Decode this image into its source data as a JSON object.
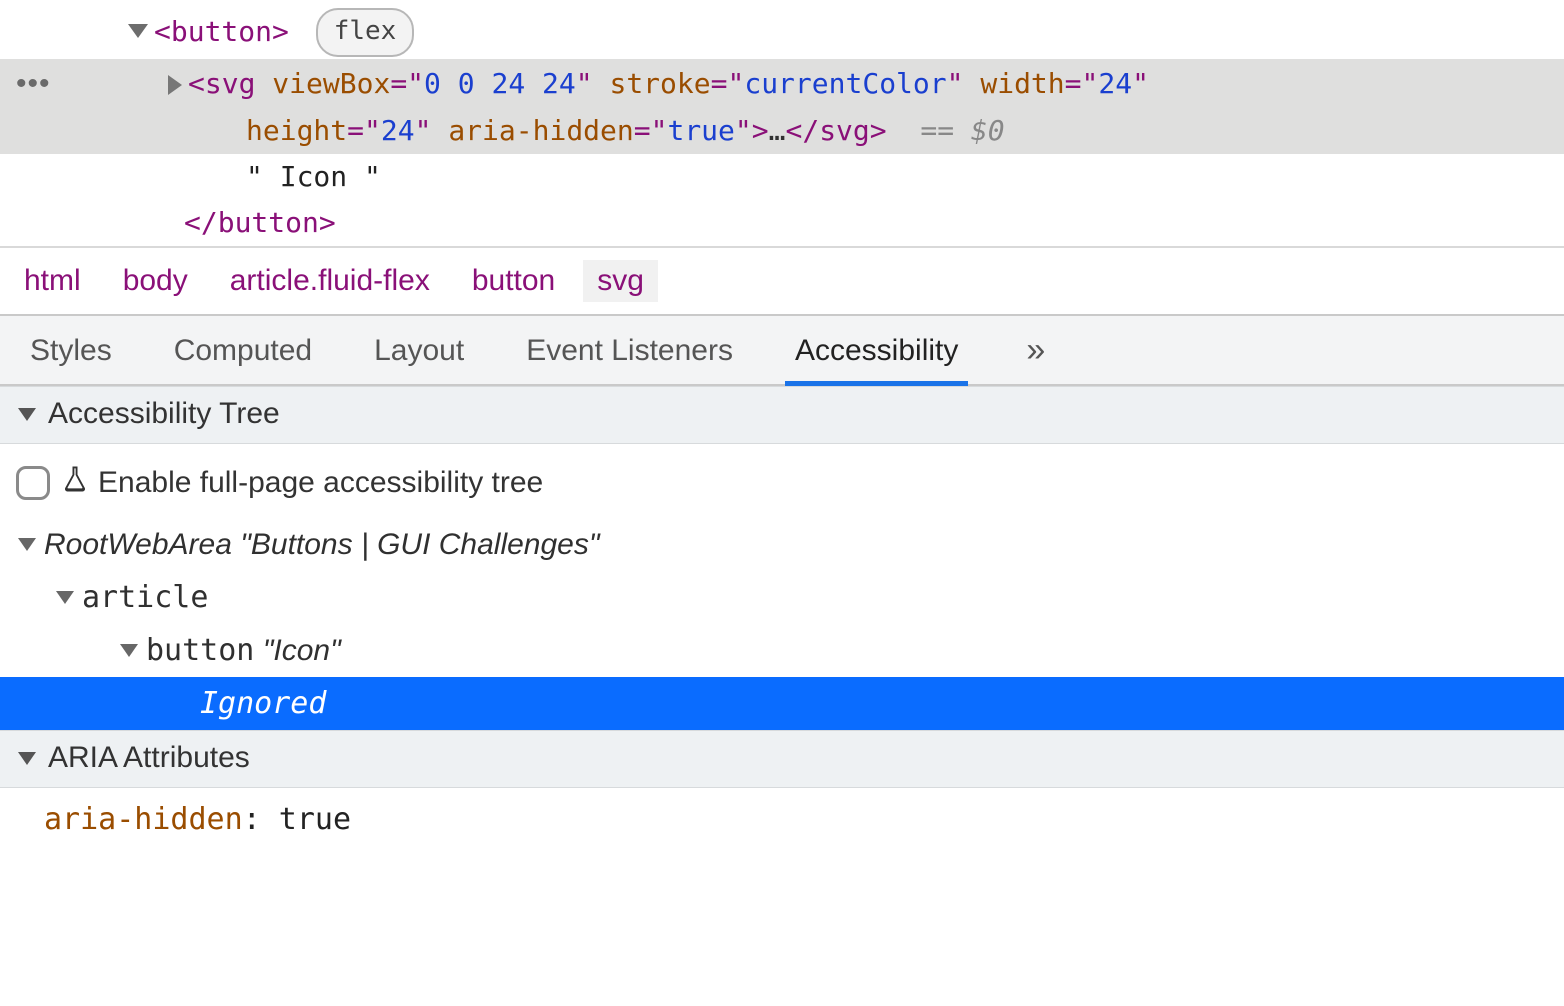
{
  "dom": {
    "button_open": "<button>",
    "button_close": "</button>",
    "flex_badge": "flex",
    "svg": {
      "prefix": "<svg",
      "attrs": [
        {
          "n": "viewBox",
          "v": "0 0 24 24"
        },
        {
          "n": "stroke",
          "v": "currentColor"
        },
        {
          "n": "width",
          "v": "24"
        },
        {
          "n": "height",
          "v": "24"
        },
        {
          "n": "aria-hidden",
          "v": "true"
        }
      ],
      "suffix_ellipsis": "…",
      "close": "</svg>",
      "eqvar": "== $0"
    },
    "text_node": "\" Icon \""
  },
  "breadcrumb": [
    "html",
    "body",
    "article.fluid-flex",
    "button",
    "svg"
  ],
  "tabs": {
    "items": [
      "Styles",
      "Computed",
      "Layout",
      "Event Listeners",
      "Accessibility"
    ],
    "active": "Accessibility",
    "more": "»"
  },
  "sections": {
    "tree_header": "Accessibility Tree",
    "aria_header": "ARIA Attributes"
  },
  "enable_label": "Enable full-page accessibility tree",
  "a11y_tree": {
    "root_role": "RootWebArea",
    "root_name": "\"Buttons | GUI Challenges\"",
    "article_role": "article",
    "button_role": "button",
    "button_name": "\"Icon\"",
    "ignored": "Ignored"
  },
  "aria_attributes": [
    {
      "name": "aria-hidden",
      "value": "true"
    }
  ]
}
